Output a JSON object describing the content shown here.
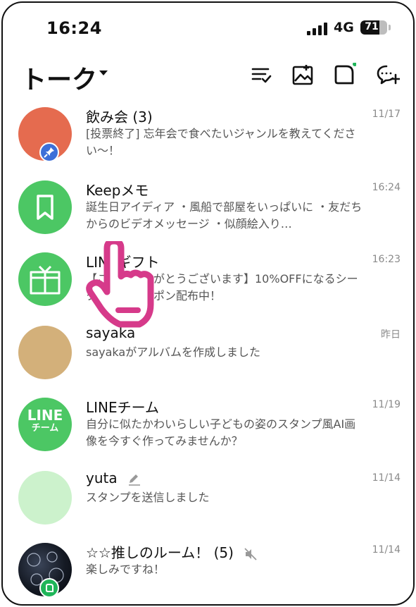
{
  "status": {
    "time": "16:24",
    "network": "4G",
    "battery": "71",
    "battery_level_pct": 71
  },
  "header": {
    "title": "トーク"
  },
  "chats": [
    {
      "name": "飲み会 (3)",
      "message": "[投票終了] 忘年会で食べたいジャンルを教えてください～！",
      "time": "11/17"
    },
    {
      "name": "Keepメモ",
      "message": "誕生日アイディア ・風船で部屋をいっぱいに ・友だちからのビデオメッセージ ・似顔絵入り…",
      "time": "16:24"
    },
    {
      "name": "LINEギフト",
      "message": "【ご参加ありがとうございます】10%OFFになるシークレットクーポン配布中！",
      "time": "16:23"
    },
    {
      "name": "sayaka",
      "message": "sayakaがアルバムを作成しました",
      "time": "昨日"
    },
    {
      "name": "LINEチーム",
      "message": "自分に似たかわいらしい子どもの姿のスタンプ風AI画像を今すぐ作ってみませんか？",
      "time": "11/19",
      "avatar_line1": "LINE",
      "avatar_line2": "チーム"
    },
    {
      "name": "yuta",
      "message": "スタンプを送信しました",
      "time": "11/14"
    },
    {
      "name": "☆☆推しのルーム！ (5)",
      "message": "楽しみですね！",
      "time": "11/14"
    }
  ],
  "colors": {
    "line_green": "#4cc764",
    "pink": "#d63a8a"
  }
}
